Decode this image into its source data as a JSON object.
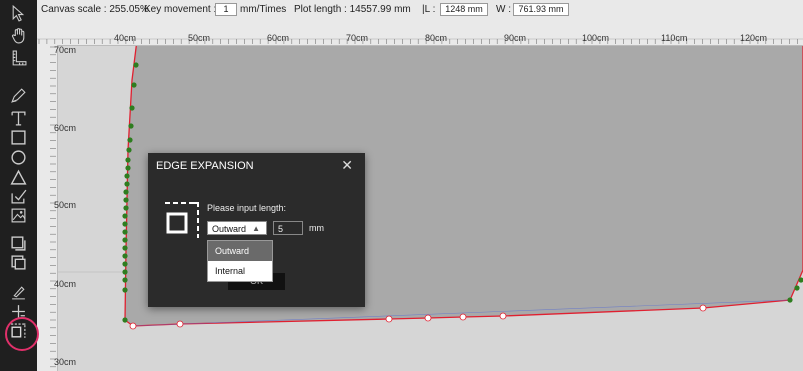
{
  "topbar": {
    "canvas_scale": "Canvas scale : 255.05%",
    "key_movement_label": "Key movement :",
    "key_movement_value": "1",
    "key_movement_unit": "mm/Times",
    "plot_length": "Plot length : 14557.99 mm",
    "l_label": "|L :",
    "l_value": "1248 mm",
    "w_label": "W :",
    "w_value": "761.93 mm"
  },
  "hruler": [
    "40cm",
    "50cm",
    "60cm",
    "70cm",
    "80cm",
    "90cm",
    "100cm",
    "110cm",
    "120cm"
  ],
  "vruler": [
    "70cm",
    "60cm",
    "50cm",
    "40cm",
    "30cm"
  ],
  "dialog": {
    "title": "EDGE EXPANSION",
    "close": "✕",
    "prompt": "Please input length:",
    "direction_value": "Outward",
    "direction_arrow": "▲",
    "length_value": "5",
    "unit": "mm",
    "ok": "OK"
  },
  "dropdown": {
    "options": [
      "Outward",
      "Internal"
    ]
  },
  "colors": {
    "toolbar": "#1f1f1f",
    "canvas": "#d6d6d6",
    "shape_fill": "#a9a9a9",
    "outline": "#e02030",
    "node": "#2e7d1f",
    "highlight": "#e0306a"
  },
  "tools": [
    "select-arrow-icon",
    "hand-pan-icon",
    "measure-ruler-icon",
    "pen-icon",
    "text-icon",
    "rectangle-icon",
    "circle-icon",
    "triangle-icon",
    "check-edit-icon",
    "image-icon",
    "copy-icon",
    "paste-layer-icon",
    "edit-node-icon",
    "plus-cursor-icon",
    "edge-expansion-icon"
  ]
}
